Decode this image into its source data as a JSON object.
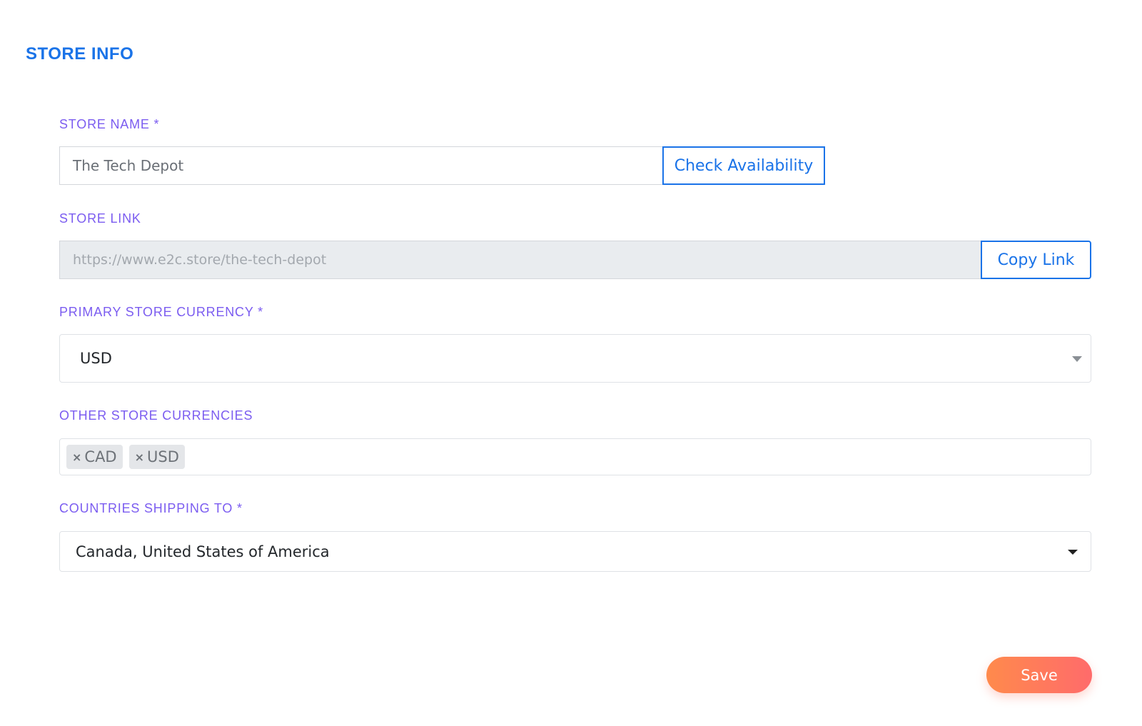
{
  "section": {
    "title": "STORE INFO"
  },
  "store_name": {
    "label": "STORE NAME *",
    "value": "The Tech Depot",
    "check_button": "Check Availability"
  },
  "store_link": {
    "label": "STORE LINK",
    "value": "https://www.e2c.store/the-tech-depot",
    "copy_button": "Copy Link"
  },
  "primary_currency": {
    "label": "PRIMARY STORE CURRENCY *",
    "selected": "USD"
  },
  "other_currencies": {
    "label": "OTHER STORE CURRENCIES",
    "tags": [
      "CAD",
      "USD"
    ],
    "remove_glyph": "×"
  },
  "countries": {
    "label": "COUNTRIES SHIPPING TO *",
    "selected": "Canada, United States of America"
  },
  "actions": {
    "save_label": "Save"
  },
  "colors": {
    "accent_blue": "#1a73e8",
    "label_purple": "#7b5cf0",
    "save_gradient_start": "#ff8a4c",
    "save_gradient_end": "#ff6b6b"
  }
}
